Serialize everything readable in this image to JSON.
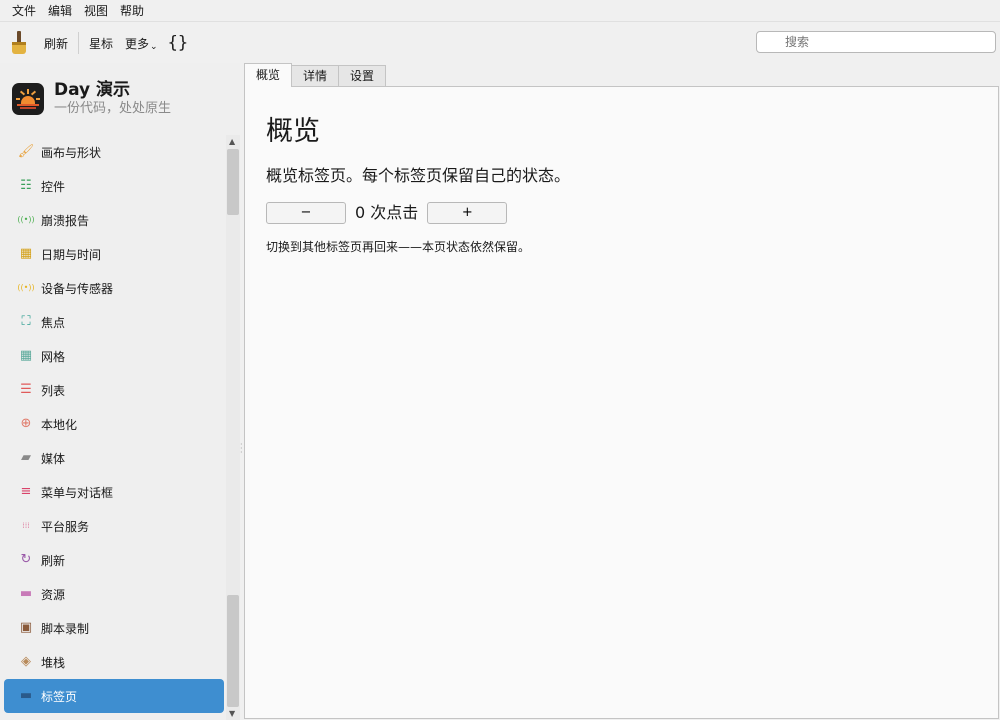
{
  "menu": [
    "文件",
    "编辑",
    "视图",
    "帮助"
  ],
  "toolbar": {
    "refresh": "刷新",
    "star": "星标",
    "more": "更多",
    "more_caret": "⌄",
    "braces": "{}",
    "search_placeholder": "搜索"
  },
  "app": {
    "title": "Day 演示",
    "subtitle": "一份代码，处处原生"
  },
  "sidebar": {
    "items": [
      {
        "label": "画布与形状",
        "icon": "paintbrush-icon",
        "glyph": "🖌",
        "color": "#e8a23c"
      },
      {
        "label": "控件",
        "icon": "sliders-icon",
        "glyph": "☷",
        "color": "#3aa05a"
      },
      {
        "label": "崩溃报告",
        "icon": "broadcast-icon",
        "glyph": "((•))",
        "color": "#4caf50"
      },
      {
        "label": "日期与时间",
        "icon": "calendar-icon",
        "glyph": "▦",
        "color": "#d4a017"
      },
      {
        "label": "设备与传感器",
        "icon": "sensor-icon",
        "glyph": "((•))",
        "color": "#e6b422"
      },
      {
        "label": "焦点",
        "icon": "focus-icon",
        "glyph": "⛶",
        "color": "#2a9d8f"
      },
      {
        "label": "网格",
        "icon": "grid-icon",
        "glyph": "▦",
        "color": "#5aa99a"
      },
      {
        "label": "列表",
        "icon": "list-icon",
        "glyph": "☰",
        "color": "#e05a5a"
      },
      {
        "label": "本地化",
        "icon": "globe-icon",
        "glyph": "⊕",
        "color": "#e07a6a"
      },
      {
        "label": "媒体",
        "icon": "clapper-icon",
        "glyph": "▰",
        "color": "#8a8a8a"
      },
      {
        "label": "菜单与对话框",
        "icon": "menu-icon",
        "glyph": "≡",
        "color": "#d9436a"
      },
      {
        "label": "平台服务",
        "icon": "dots-grid-icon",
        "glyph": "⁞⁞⁞",
        "color": "#e08aa8"
      },
      {
        "label": "刷新",
        "icon": "refresh-icon",
        "glyph": "↻",
        "color": "#9a5aa8"
      },
      {
        "label": "资源",
        "icon": "folder-icon",
        "glyph": "▬",
        "color": "#c87ab8"
      },
      {
        "label": "脚本录制",
        "icon": "terminal-icon",
        "glyph": "▣",
        "color": "#8a5a3a"
      },
      {
        "label": "堆栈",
        "icon": "layers-icon",
        "glyph": "◈",
        "color": "#b88a5a"
      },
      {
        "label": "标签页",
        "icon": "tabs-icon",
        "glyph": "▬",
        "color": "#2a5a8a",
        "active": true
      }
    ]
  },
  "tabs": [
    "概览",
    "详情",
    "设置"
  ],
  "panel": {
    "title": "概览",
    "description": "概览标签页。每个标签页保留自己的状态。",
    "minus": "−",
    "plus": "+",
    "count_text": "0 次点击",
    "note": "切换到其他标签页再回来——本页状态依然保留。"
  },
  "colors": {
    "active_nav": "#3e8ed0",
    "panel_bg": "#fafafa"
  }
}
